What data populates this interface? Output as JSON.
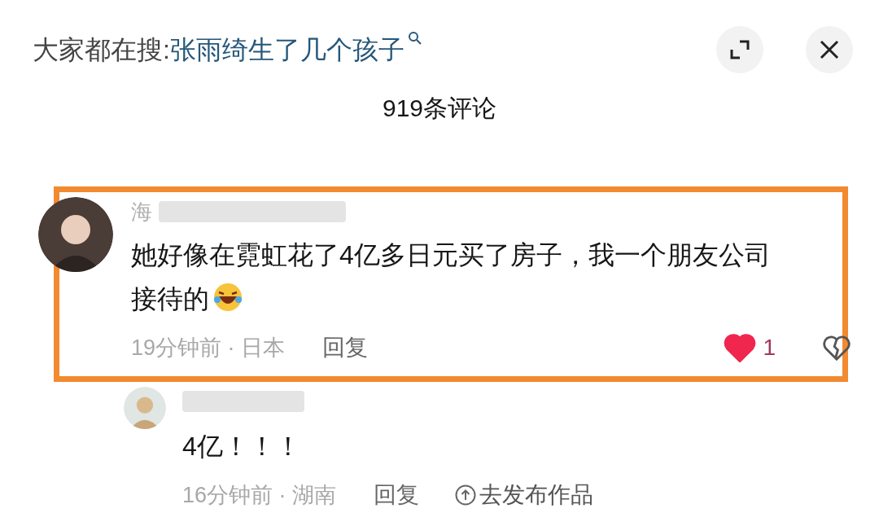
{
  "header": {
    "search_prefix": "大家都在搜:",
    "search_term": "张雨绮生了几个孩子"
  },
  "title": "919条评论",
  "comments": [
    {
      "kind": "main",
      "name": "海",
      "text": "她好像在霓虹花了4亿多日元买了房子，我一个朋友公司接待的",
      "emoji": true,
      "time": "19分钟前 · 日本",
      "reply": "回复",
      "likes": "1",
      "liked": true
    },
    {
      "kind": "reply",
      "text": "4亿！！！",
      "time": "16分钟前 · 湖南",
      "reply": "回复",
      "publish": "去发布作品"
    }
  ]
}
